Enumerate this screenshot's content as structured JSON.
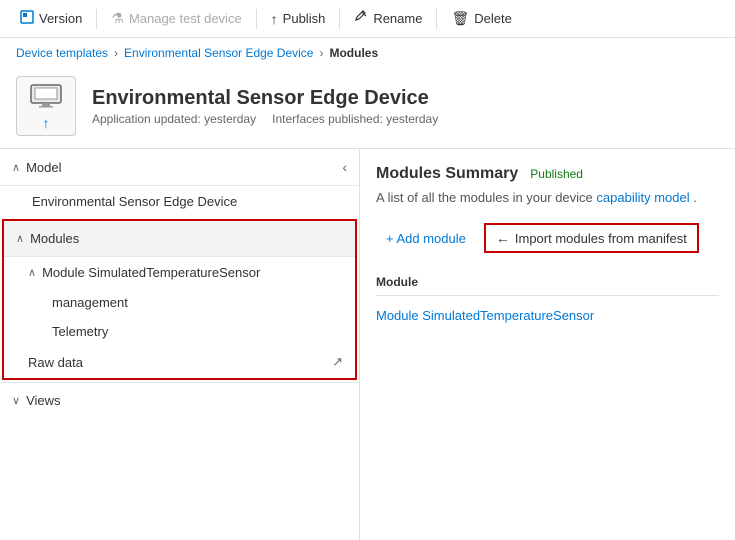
{
  "toolbar": {
    "items": [
      {
        "id": "version",
        "label": "Version",
        "icon": "🔲",
        "disabled": false
      },
      {
        "id": "manage-test-device",
        "label": "Manage test device",
        "icon": "🧪",
        "disabled": true
      },
      {
        "id": "publish",
        "label": "Publish",
        "icon": "↑",
        "disabled": false
      },
      {
        "id": "rename",
        "label": "Rename",
        "icon": "✏️",
        "disabled": false
      },
      {
        "id": "delete",
        "label": "Delete",
        "icon": "🗑",
        "disabled": false
      }
    ]
  },
  "breadcrumb": {
    "items": [
      "Device templates",
      "Environmental Sensor Edge Device"
    ],
    "current": "Modules"
  },
  "header": {
    "title": "Environmental Sensor Edge Device",
    "updated": "Application updated: yesterday",
    "interfaces": "Interfaces published: yesterday"
  },
  "left_nav": {
    "model_section": "Model",
    "model_item": "Environmental Sensor Edge Device",
    "modules_section": "Modules",
    "module_name": "Module SimulatedTemperatureSensor",
    "module_subitems": [
      "management",
      "Telemetry"
    ],
    "raw_data": "Raw data",
    "views_section": "Views"
  },
  "right_panel": {
    "title": "Modules Summary",
    "status": "Published",
    "description": "A list of all the modules in your device",
    "description_link": "capability model",
    "description_end": ".",
    "add_module_label": "+ Add module",
    "import_label": "Import modules from manifest",
    "import_icon": "←",
    "table_header": "Module",
    "module_link": "Module SimulatedTemperatureSensor"
  }
}
